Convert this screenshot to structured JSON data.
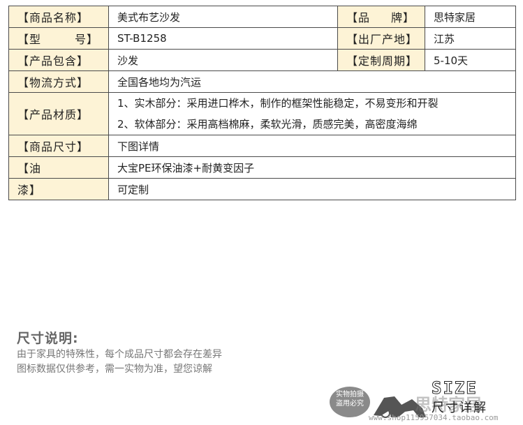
{
  "spec_table": {
    "row1": {
      "label_left": "商品名称",
      "value_left": "美式布艺沙发",
      "label_right_a": "品",
      "label_right_b": "牌",
      "value_right": "思特家居"
    },
    "row2": {
      "label_a": "型",
      "label_b": "号",
      "value_left": "ST-B1258",
      "label_right": "出厂产地",
      "value_right": "江苏"
    },
    "row3": {
      "label_left": "产品包含",
      "value_left": "沙发",
      "label_right": "定制周期",
      "value_right": "5-10天"
    },
    "row4": {
      "label": "物流方式",
      "value": "全国各地均为汽运"
    },
    "row5": {
      "label": "产品材质",
      "line1": "1、实木部分：采用进口桦木，制作的框架性能稳定，不易变形和开裂",
      "line2": "2、软体部分：采用高档棉麻，柔软光滑，质感完美，高密度海绵"
    },
    "row6": {
      "label": "商品尺寸",
      "value": "下图详情"
    },
    "row7": {
      "label": "油",
      "value": "大宝PE环保油漆+耐黄变因子"
    },
    "row8": {
      "label": "漆",
      "value": "可定制"
    }
  },
  "note": {
    "title": "尺寸说明:",
    "line1": "由于家具的特殊性，每个成品尺寸都会存在差异",
    "line2": "图标数据仅供参考，需一实物为准，望您谅解"
  },
  "banner": {
    "stamp_line1": "实物拍摄",
    "stamp_line2": "盗用必究",
    "size_word": "SIZE",
    "size_sub": "尺寸详解",
    "watermark": "思特家居",
    "url": "www.shop115957034.taobao.com"
  }
}
